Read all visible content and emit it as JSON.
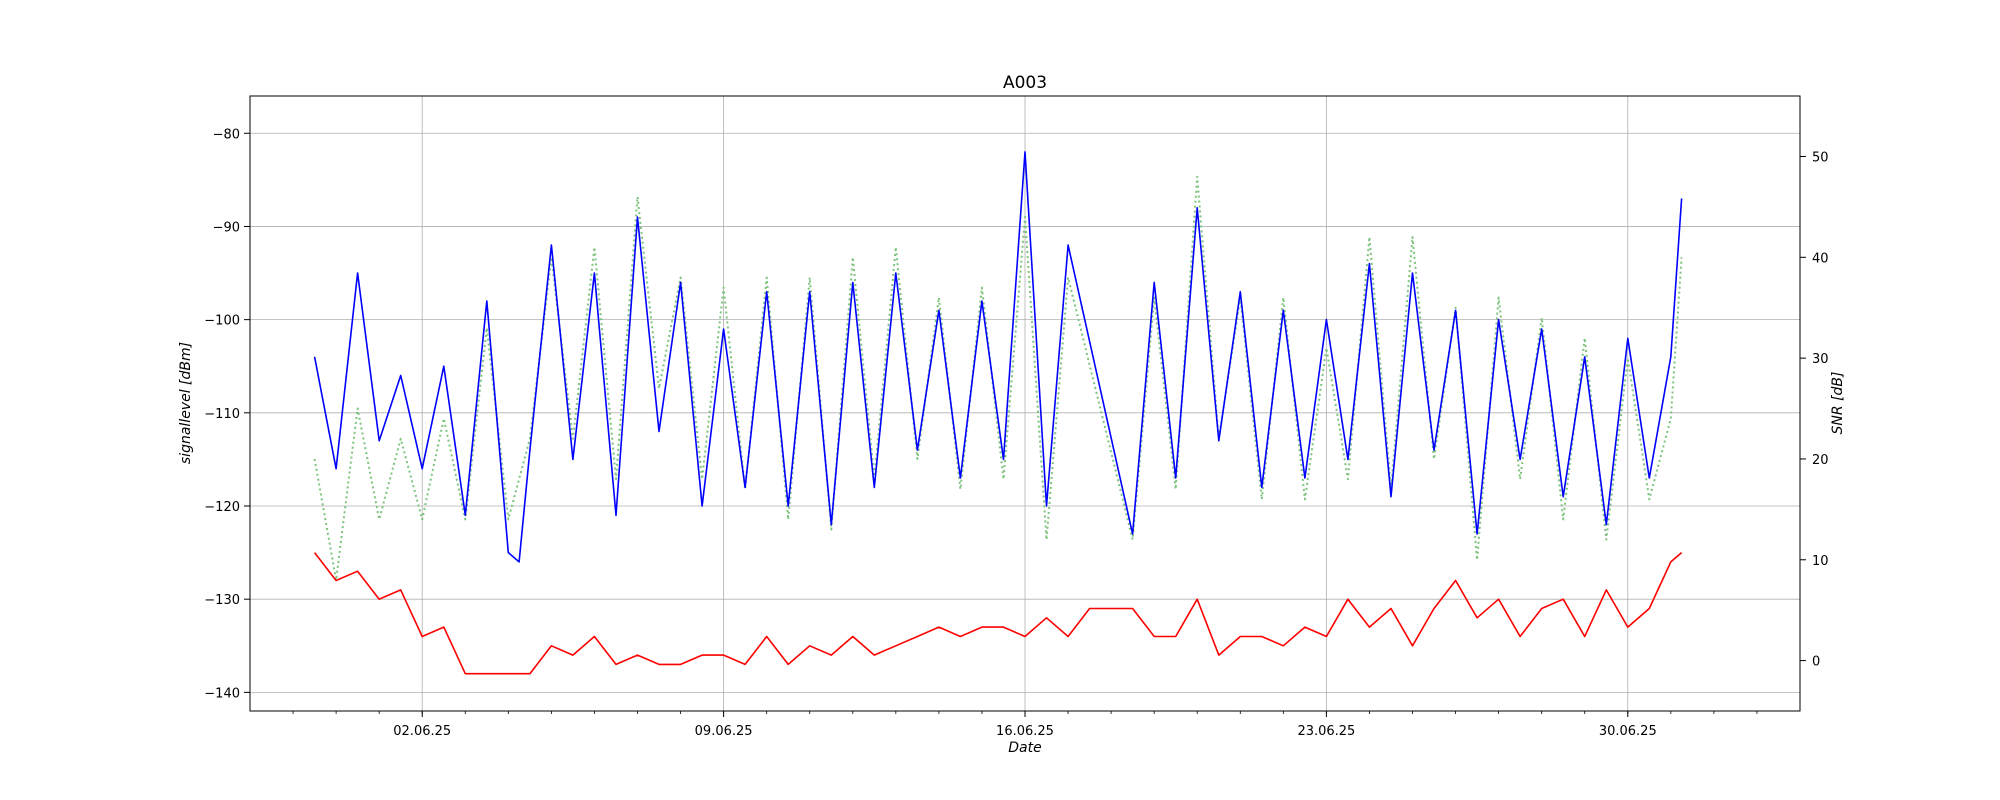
{
  "chart_data": {
    "type": "line",
    "title": "A003",
    "xlabel": "Date",
    "ylabel_left": "signallevel [dBm]",
    "ylabel_right": "SNR [dB]",
    "grid": true,
    "x_range": [
      "2025-05-29",
      "2025-07-04"
    ],
    "ylim_left": [
      -142,
      -76
    ],
    "ylim_right": [
      -5,
      56
    ],
    "x_ticks": [
      "02.06.25",
      "09.06.25",
      "16.06.25",
      "23.06.25",
      "30.06.25"
    ],
    "y_ticks_left": [
      -80,
      -90,
      -100,
      -110,
      -120,
      -130,
      -140
    ],
    "y_ticks_right": [
      50,
      40,
      30,
      20,
      10,
      0
    ],
    "series": [
      {
        "axis": "left",
        "color": "#0000ff",
        "style": "solid",
        "points": [
          [
            "2025-05-30T12:00",
            -104
          ],
          [
            "2025-05-31T00:00",
            -116
          ],
          [
            "2025-05-31T12:00",
            -95
          ],
          [
            "2025-06-01T00:00",
            -113
          ],
          [
            "2025-06-01T12:00",
            -106
          ],
          [
            "2025-06-02T00:00",
            -116
          ],
          [
            "2025-06-02T12:00",
            -105
          ],
          [
            "2025-06-03T00:00",
            -121
          ],
          [
            "2025-06-03T12:00",
            -98
          ],
          [
            "2025-06-04T00:00",
            -125
          ],
          [
            "2025-06-04T06:00",
            -126
          ],
          [
            "2025-06-04T12:00",
            -114
          ],
          [
            "2025-06-05T00:00",
            -92
          ],
          [
            "2025-06-05T12:00",
            -115
          ],
          [
            "2025-06-06T00:00",
            -95
          ],
          [
            "2025-06-06T12:00",
            -121
          ],
          [
            "2025-06-07T00:00",
            -89
          ],
          [
            "2025-06-07T12:00",
            -112
          ],
          [
            "2025-06-08T00:00",
            -96
          ],
          [
            "2025-06-08T12:00",
            -120
          ],
          [
            "2025-06-09T00:00",
            -101
          ],
          [
            "2025-06-09T12:00",
            -118
          ],
          [
            "2025-06-10T00:00",
            -97
          ],
          [
            "2025-06-10T12:00",
            -120
          ],
          [
            "2025-06-11T00:00",
            -97
          ],
          [
            "2025-06-11T12:00",
            -122
          ],
          [
            "2025-06-12T00:00",
            -96
          ],
          [
            "2025-06-12T12:00",
            -118
          ],
          [
            "2025-06-13T00:00",
            -95
          ],
          [
            "2025-06-13T12:00",
            -114
          ],
          [
            "2025-06-14T00:00",
            -99
          ],
          [
            "2025-06-14T12:00",
            -117
          ],
          [
            "2025-06-15T00:00",
            -98
          ],
          [
            "2025-06-15T12:00",
            -115
          ],
          [
            "2025-06-16T00:00",
            -82
          ],
          [
            "2025-06-16T12:00",
            -120
          ],
          [
            "2025-06-17T00:00",
            -92
          ],
          [
            "2025-06-18T12:00",
            -123
          ],
          [
            "2025-06-19T00:00",
            -96
          ],
          [
            "2025-06-19T12:00",
            -117
          ],
          [
            "2025-06-20T00:00",
            -88
          ],
          [
            "2025-06-20T12:00",
            -113
          ],
          [
            "2025-06-21T00:00",
            -97
          ],
          [
            "2025-06-21T12:00",
            -118
          ],
          [
            "2025-06-22T00:00",
            -99
          ],
          [
            "2025-06-22T12:00",
            -117
          ],
          [
            "2025-06-23T00:00",
            -100
          ],
          [
            "2025-06-23T12:00",
            -115
          ],
          [
            "2025-06-24T00:00",
            -94
          ],
          [
            "2025-06-24T12:00",
            -119
          ],
          [
            "2025-06-25T00:00",
            -95
          ],
          [
            "2025-06-25T12:00",
            -114
          ],
          [
            "2025-06-26T00:00",
            -99
          ],
          [
            "2025-06-26T12:00",
            -123
          ],
          [
            "2025-06-27T00:00",
            -100
          ],
          [
            "2025-06-27T12:00",
            -115
          ],
          [
            "2025-06-28T00:00",
            -101
          ],
          [
            "2025-06-28T12:00",
            -119
          ],
          [
            "2025-06-29T00:00",
            -104
          ],
          [
            "2025-06-29T12:00",
            -122
          ],
          [
            "2025-06-30T00:00",
            -102
          ],
          [
            "2025-06-30T12:00",
            -117
          ],
          [
            "2025-07-01T00:00",
            -104
          ],
          [
            "2025-07-01T06:00",
            -87
          ]
        ]
      },
      {
        "axis": "left",
        "color": "#ff0000",
        "style": "solid",
        "points": [
          [
            "2025-05-30T12:00",
            -125
          ],
          [
            "2025-05-31T00:00",
            -128
          ],
          [
            "2025-05-31T12:00",
            -127
          ],
          [
            "2025-06-01T00:00",
            -130
          ],
          [
            "2025-06-01T12:00",
            -129
          ],
          [
            "2025-06-02T00:00",
            -134
          ],
          [
            "2025-06-02T12:00",
            -133
          ],
          [
            "2025-06-03T00:00",
            -138
          ],
          [
            "2025-06-03T12:00",
            -138
          ],
          [
            "2025-06-04T00:00",
            -138
          ],
          [
            "2025-06-04T12:00",
            -138
          ],
          [
            "2025-06-05T00:00",
            -135
          ],
          [
            "2025-06-05T12:00",
            -136
          ],
          [
            "2025-06-06T00:00",
            -134
          ],
          [
            "2025-06-06T12:00",
            -137
          ],
          [
            "2025-06-07T00:00",
            -136
          ],
          [
            "2025-06-07T12:00",
            -137
          ],
          [
            "2025-06-08T00:00",
            -137
          ],
          [
            "2025-06-08T12:00",
            -136
          ],
          [
            "2025-06-09T00:00",
            -136
          ],
          [
            "2025-06-09T12:00",
            -137
          ],
          [
            "2025-06-10T00:00",
            -134
          ],
          [
            "2025-06-10T12:00",
            -137
          ],
          [
            "2025-06-11T00:00",
            -135
          ],
          [
            "2025-06-11T12:00",
            -136
          ],
          [
            "2025-06-12T00:00",
            -134
          ],
          [
            "2025-06-12T12:00",
            -136
          ],
          [
            "2025-06-13T00:00",
            -135
          ],
          [
            "2025-06-13T12:00",
            -134
          ],
          [
            "2025-06-14T00:00",
            -133
          ],
          [
            "2025-06-14T12:00",
            -134
          ],
          [
            "2025-06-15T00:00",
            -133
          ],
          [
            "2025-06-15T12:00",
            -133
          ],
          [
            "2025-06-16T00:00",
            -134
          ],
          [
            "2025-06-16T12:00",
            -132
          ],
          [
            "2025-06-17T00:00",
            -134
          ],
          [
            "2025-06-17T12:00",
            -131
          ],
          [
            "2025-06-18T12:00",
            -131
          ],
          [
            "2025-06-19T00:00",
            -134
          ],
          [
            "2025-06-19T12:00",
            -134
          ],
          [
            "2025-06-20T00:00",
            -130
          ],
          [
            "2025-06-20T12:00",
            -136
          ],
          [
            "2025-06-21T00:00",
            -134
          ],
          [
            "2025-06-21T12:00",
            -134
          ],
          [
            "2025-06-22T00:00",
            -135
          ],
          [
            "2025-06-22T12:00",
            -133
          ],
          [
            "2025-06-23T00:00",
            -134
          ],
          [
            "2025-06-23T12:00",
            -130
          ],
          [
            "2025-06-24T00:00",
            -133
          ],
          [
            "2025-06-24T12:00",
            -131
          ],
          [
            "2025-06-25T00:00",
            -135
          ],
          [
            "2025-06-25T12:00",
            -131
          ],
          [
            "2025-06-26T00:00",
            -128
          ],
          [
            "2025-06-26T12:00",
            -132
          ],
          [
            "2025-06-27T00:00",
            -130
          ],
          [
            "2025-06-27T12:00",
            -134
          ],
          [
            "2025-06-28T00:00",
            -131
          ],
          [
            "2025-06-28T12:00",
            -130
          ],
          [
            "2025-06-29T00:00",
            -134
          ],
          [
            "2025-06-29T12:00",
            -129
          ],
          [
            "2025-06-30T00:00",
            -133
          ],
          [
            "2025-06-30T12:00",
            -131
          ],
          [
            "2025-07-01T00:00",
            -126
          ],
          [
            "2025-07-01T06:00",
            -125
          ]
        ]
      },
      {
        "axis": "right",
        "color": "#7cc47c",
        "style": "dotted",
        "points": [
          [
            "2025-05-30T12:00",
            20
          ],
          [
            "2025-05-31T00:00",
            8
          ],
          [
            "2025-05-31T12:00",
            25
          ],
          [
            "2025-06-01T00:00",
            14
          ],
          [
            "2025-06-01T12:00",
            22
          ],
          [
            "2025-06-02T00:00",
            14
          ],
          [
            "2025-06-02T12:00",
            24
          ],
          [
            "2025-06-03T00:00",
            14
          ],
          [
            "2025-06-03T12:00",
            33
          ],
          [
            "2025-06-04T00:00",
            14
          ],
          [
            "2025-06-04T12:00",
            22
          ],
          [
            "2025-06-05T00:00",
            40
          ],
          [
            "2025-06-05T12:00",
            22
          ],
          [
            "2025-06-06T00:00",
            41
          ],
          [
            "2025-06-06T12:00",
            18
          ],
          [
            "2025-06-07T00:00",
            46
          ],
          [
            "2025-06-07T12:00",
            27
          ],
          [
            "2025-06-08T00:00",
            38
          ],
          [
            "2025-06-08T12:00",
            18
          ],
          [
            "2025-06-09T00:00",
            37
          ],
          [
            "2025-06-09T12:00",
            17
          ],
          [
            "2025-06-10T00:00",
            38
          ],
          [
            "2025-06-10T12:00",
            14
          ],
          [
            "2025-06-11T00:00",
            38
          ],
          [
            "2025-06-11T12:00",
            13
          ],
          [
            "2025-06-12T00:00",
            40
          ],
          [
            "2025-06-12T12:00",
            18
          ],
          [
            "2025-06-13T00:00",
            41
          ],
          [
            "2025-06-13T12:00",
            20
          ],
          [
            "2025-06-14T00:00",
            36
          ],
          [
            "2025-06-14T12:00",
            17
          ],
          [
            "2025-06-15T00:00",
            37
          ],
          [
            "2025-06-15T12:00",
            18
          ],
          [
            "2025-06-16T00:00",
            44
          ],
          [
            "2025-06-16T12:00",
            12
          ],
          [
            "2025-06-17T00:00",
            38
          ],
          [
            "2025-06-18T12:00",
            12
          ],
          [
            "2025-06-19T00:00",
            36
          ],
          [
            "2025-06-19T12:00",
            17
          ],
          [
            "2025-06-20T00:00",
            48
          ],
          [
            "2025-06-20T12:00",
            22
          ],
          [
            "2025-06-21T00:00",
            36
          ],
          [
            "2025-06-21T12:00",
            16
          ],
          [
            "2025-06-22T00:00",
            36
          ],
          [
            "2025-06-22T12:00",
            16
          ],
          [
            "2025-06-23T00:00",
            31
          ],
          [
            "2025-06-23T12:00",
            18
          ],
          [
            "2025-06-24T00:00",
            42
          ],
          [
            "2025-06-24T12:00",
            17
          ],
          [
            "2025-06-25T00:00",
            42
          ],
          [
            "2025-06-25T12:00",
            20
          ],
          [
            "2025-06-26T00:00",
            35
          ],
          [
            "2025-06-26T12:00",
            10
          ],
          [
            "2025-06-27T00:00",
            36
          ],
          [
            "2025-06-27T12:00",
            18
          ],
          [
            "2025-06-28T00:00",
            34
          ],
          [
            "2025-06-28T12:00",
            14
          ],
          [
            "2025-06-29T00:00",
            32
          ],
          [
            "2025-06-29T12:00",
            12
          ],
          [
            "2025-06-30T00:00",
            30
          ],
          [
            "2025-06-30T12:00",
            16
          ],
          [
            "2025-07-01T00:00",
            24
          ],
          [
            "2025-07-01T06:00",
            40
          ]
        ]
      }
    ]
  }
}
